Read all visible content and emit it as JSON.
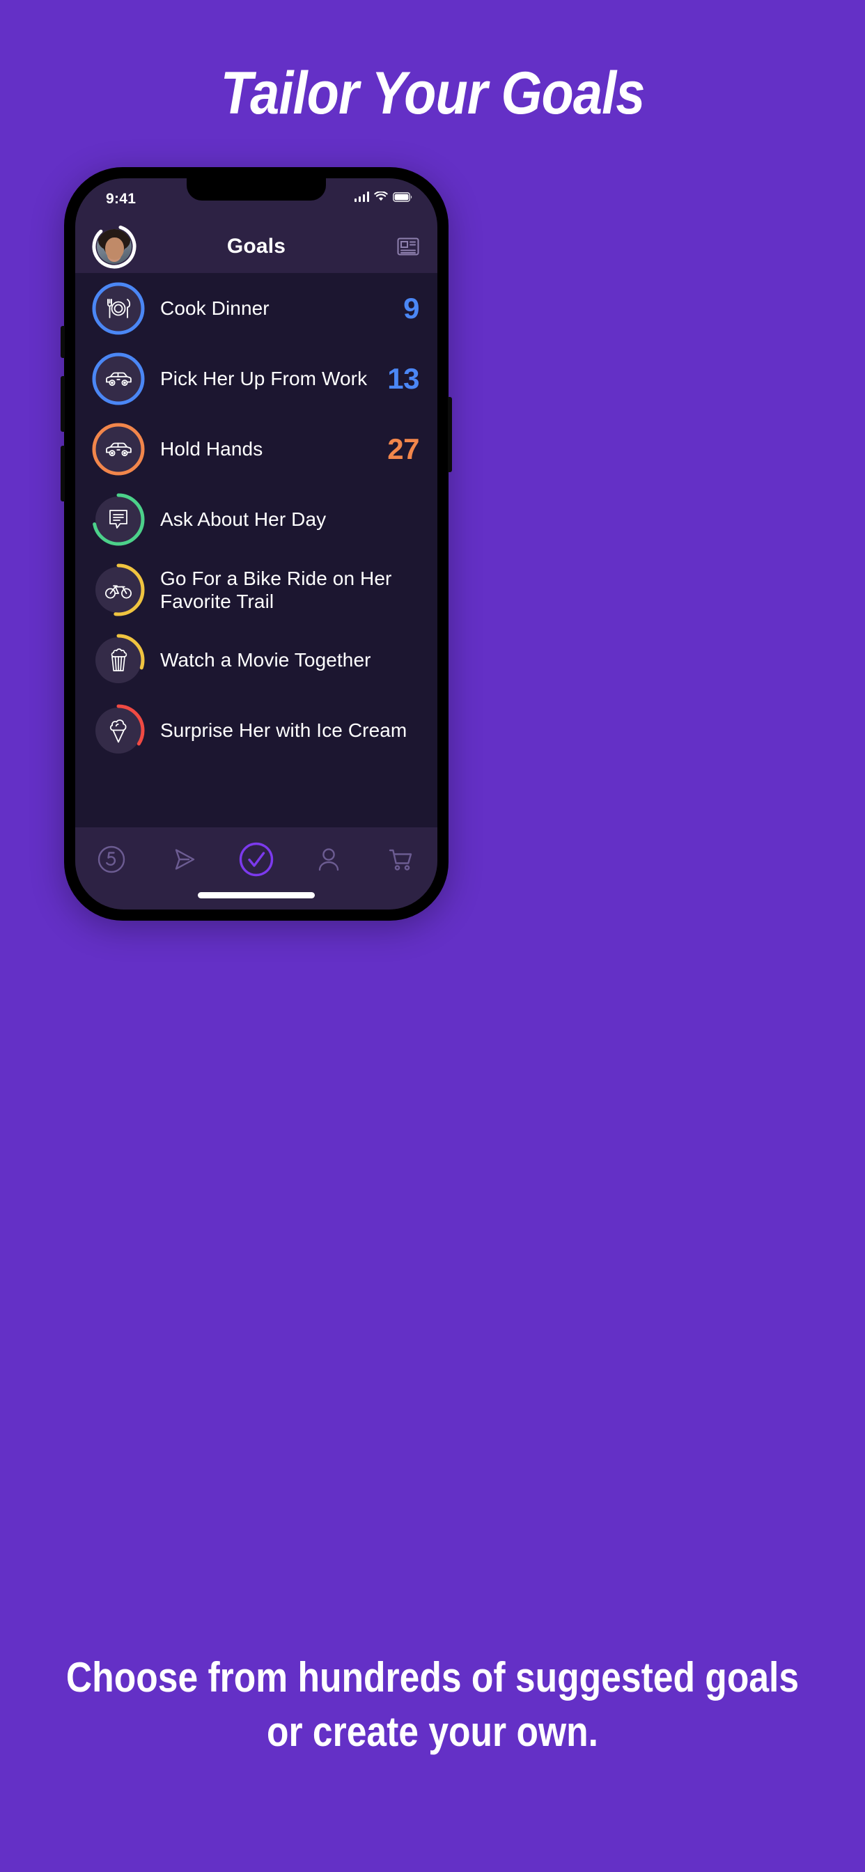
{
  "headline": "Tailor Your Goals",
  "caption": "Choose from hundreds of suggested goals or create your own.",
  "colors": {
    "background": "#6430C6",
    "screen_dark": "#1C1630",
    "chrome": "#2D2244",
    "blue": "#4B87F5",
    "orange": "#F2864B",
    "green": "#4CD18A",
    "yellow": "#F0C440",
    "red": "#F04A43",
    "accent_purple": "#7C3AED"
  },
  "status_bar": {
    "time": "9:41",
    "signal_icon": "cellular-bars-icon",
    "wifi_icon": "wifi-icon",
    "battery_icon": "battery-icon"
  },
  "nav_bar": {
    "avatar_label": "profile-avatar",
    "title": "Goals",
    "right_icon": "article-icon"
  },
  "goals": [
    {
      "title": "Cook Dinner",
      "count": "9",
      "color": "#4B87F5",
      "icon": "cutlery-plate-icon",
      "progress": 100
    },
    {
      "title": "Pick Her Up From Work",
      "count": "13",
      "color": "#4B87F5",
      "icon": "car-icon",
      "progress": 100
    },
    {
      "title": "Hold Hands",
      "count": "27",
      "color": "#F2864B",
      "icon": "car-icon",
      "progress": 100
    },
    {
      "title": "Ask About Her Day",
      "count": "",
      "color": "#4CD18A",
      "icon": "chat-bubble-icon",
      "progress": 72
    },
    {
      "title": "Go For a Bike Ride on Her Favorite Trail",
      "count": "",
      "color": "#F0C440",
      "icon": "bicycle-icon",
      "progress": 52
    },
    {
      "title": "Watch a Movie Together",
      "count": "",
      "color": "#F0C440",
      "icon": "popcorn-icon",
      "progress": 30
    },
    {
      "title": "Surprise Her with Ice Cream",
      "count": "",
      "color": "#F04A43",
      "icon": "ice-cream-icon",
      "progress": 34
    }
  ],
  "tab_bar": {
    "items": [
      {
        "name": "five-circle-icon",
        "active": false
      },
      {
        "name": "send-icon",
        "active": false
      },
      {
        "name": "check-circle-icon",
        "active": true
      },
      {
        "name": "person-icon",
        "active": false
      },
      {
        "name": "cart-icon",
        "active": false
      }
    ]
  }
}
